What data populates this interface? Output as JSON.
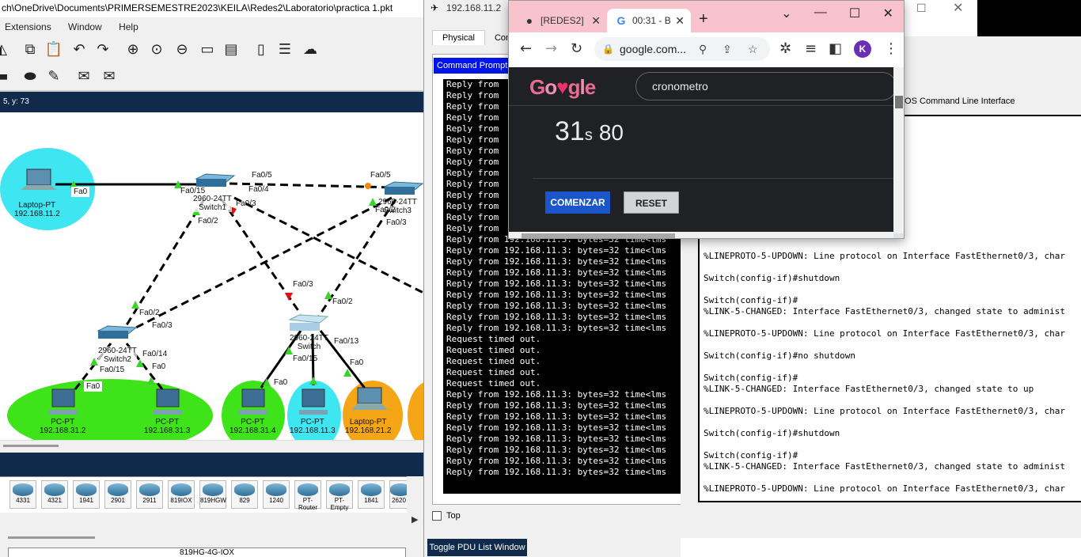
{
  "packet_tracer": {
    "title": "ch\\OneDrive\\Documents\\PRIMERSEMESTRE2023\\KEILA\\Redes2\\Laboratorio\\practica 1.pkt",
    "menu": [
      "Extensions",
      "Window",
      "Help"
    ],
    "coords": "5, y: 73",
    "devices": [
      {
        "name": "Laptop-PT",
        "ip": "192.168.11.2"
      },
      {
        "name": "Switch1",
        "model": "2960-24TT"
      },
      {
        "name": "Switch2",
        "model": "2960-24TT"
      },
      {
        "name": "Switch3",
        "model": "2960-24TT"
      },
      {
        "name": "Switch",
        "model": "2960-24TT"
      },
      {
        "name": "PC-PT",
        "ip": "192.168.31.2"
      },
      {
        "name": "PC-PT",
        "ip": "192.168.31.3"
      },
      {
        "name": "PC-PT",
        "ip": "192.168.31.4"
      },
      {
        "name": "PC-PT",
        "ip": "192.168.11.3"
      },
      {
        "name": "Laptop-PT",
        "ip": "192.168.21.2"
      }
    ],
    "ports": [
      "Fa0",
      "Fa0/15",
      "Fa0/5",
      "Fa0/4",
      "Fa0/3",
      "Fa0/2",
      "Fa0/14",
      "Fa0/13"
    ],
    "device_palette": [
      "4331",
      "4321",
      "1941",
      "2901",
      "2911",
      "819IOX",
      "819HGW",
      "829",
      "1240",
      "PT-Router",
      "PT-Empty",
      "1841",
      "2620"
    ],
    "selected_model": "819HG-4G-IOX"
  },
  "device_window": {
    "title": "192.168.11.2",
    "tabs": [
      "Physical",
      "Conf"
    ],
    "cmd_title": "Command Prompt",
    "cmd_lines": [
      "Reply from",
      "Reply from",
      "Reply from",
      "Reply from",
      "Reply from",
      "Reply from",
      "Reply from",
      "Reply from",
      "Reply from",
      "Reply from",
      "Reply from",
      "Reply from",
      "Reply from",
      "Reply from",
      "Reply from 192.168.11.3: bytes=32 time<lms",
      "Reply from 192.168.11.3: bytes=32 time<lms",
      "Reply from 192.168.11.3: bytes=32 time<lms",
      "Reply from 192.168.11.3: bytes=32 time<lms",
      "Reply from 192.168.11.3: bytes=32 time<lms",
      "Reply from 192.168.11.3: bytes=32 time<lms",
      "Reply from 192.168.11.3: bytes=32 time<lms",
      "Reply from 192.168.11.3: bytes=32 time<lms",
      "Reply from 192.168.11.3: bytes=32 time<lms",
      "Request timed out.",
      "Request timed out.",
      "Request timed out.",
      "Request timed out.",
      "Request timed out.",
      "Reply from 192.168.11.3: bytes=32 time<lms",
      "Reply from 192.168.11.3: bytes=32 time<lms",
      "Reply from 192.168.11.3: bytes=32 time<lms",
      "Reply from 192.168.11.3: bytes=32 time<lms",
      "Reply from 192.168.11.3: bytes=32 time<lms",
      "Reply from 192.168.11.3: bytes=32 time<lms",
      "Reply from 192.168.11.3: bytes=32 time<lms",
      "Reply from 192.168.11.3: bytes=32 time<lms"
    ],
    "top_label": "Top",
    "pdu_button": "Toggle PDU List Window"
  },
  "cli_window": {
    "label": "IOS Command Line Interface",
    "lines": [
      "",
      "",
      "",
      "et0/3, changed state to administ",
      "",
      "on Interface FastEthernet0/3, char",
      "",
      "",
      "",
      "",
      "et0/3, changed state to up",
      "",
      "%LINEPROTO-5-UPDOWN: Line protocol on Interface FastEthernet0/3, char",
      "",
      "Switch(config-if)#shutdown",
      "",
      "Switch(config-if)#",
      "%LINK-5-CHANGED: Interface FastEthernet0/3, changed state to administ",
      "",
      "%LINEPROTO-5-UPDOWN: Line protocol on Interface FastEthernet0/3, char",
      "",
      "Switch(config-if)#no shutdown",
      "",
      "Switch(config-if)#",
      "%LINK-5-CHANGED: Interface FastEthernet0/3, changed state to up",
      "",
      "%LINEPROTO-5-UPDOWN: Line protocol on Interface FastEthernet0/3, char",
      "",
      "Switch(config-if)#shutdown",
      "",
      "Switch(config-if)#",
      "%LINK-5-CHANGED: Interface FastEthernet0/3, changed state to administ",
      "",
      "%LINEPROTO-5-UPDOWN: Line protocol on Interface FastEthernet0/3, char"
    ]
  },
  "chrome": {
    "tab1_title": "[REDES2]",
    "tab2_title": "00:31 - B",
    "url": "google.com...",
    "avatar_letter": "K",
    "search_query": "cronometro",
    "timer_seconds": "31",
    "timer_unit": "s",
    "timer_ms": "80",
    "start_label": "COMENZAR",
    "reset_label": "RESET"
  }
}
